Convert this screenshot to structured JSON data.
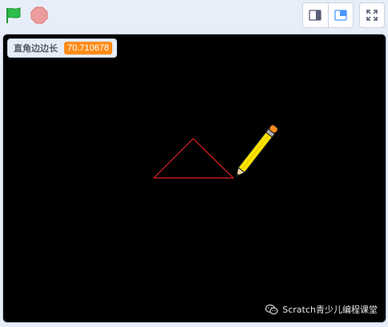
{
  "toolbar": {
    "green_flag_icon": "green-flag-icon",
    "stop_icon": "stop-sign-icon",
    "small_stage_icon": "small-stage-layout-icon",
    "normal_stage_icon": "normal-stage-layout-icon",
    "fullscreen_icon": "fullscreen-icon"
  },
  "stage": {
    "monitor": {
      "label": "直角边边长",
      "value": "70.710678"
    },
    "watermark": {
      "icon": "wechat-icon",
      "text": "Scratch青少儿编程课堂"
    },
    "sprite_icon": "pencil-icon"
  },
  "colors": {
    "flag_green": "#2dbe4b",
    "stop_red": "#ec9c9c",
    "monitor_value_bg": "#ff8c1a",
    "pen_line": "#e02020",
    "stage_bg": "#000000",
    "toolbar_bg": "#e8eef9"
  }
}
